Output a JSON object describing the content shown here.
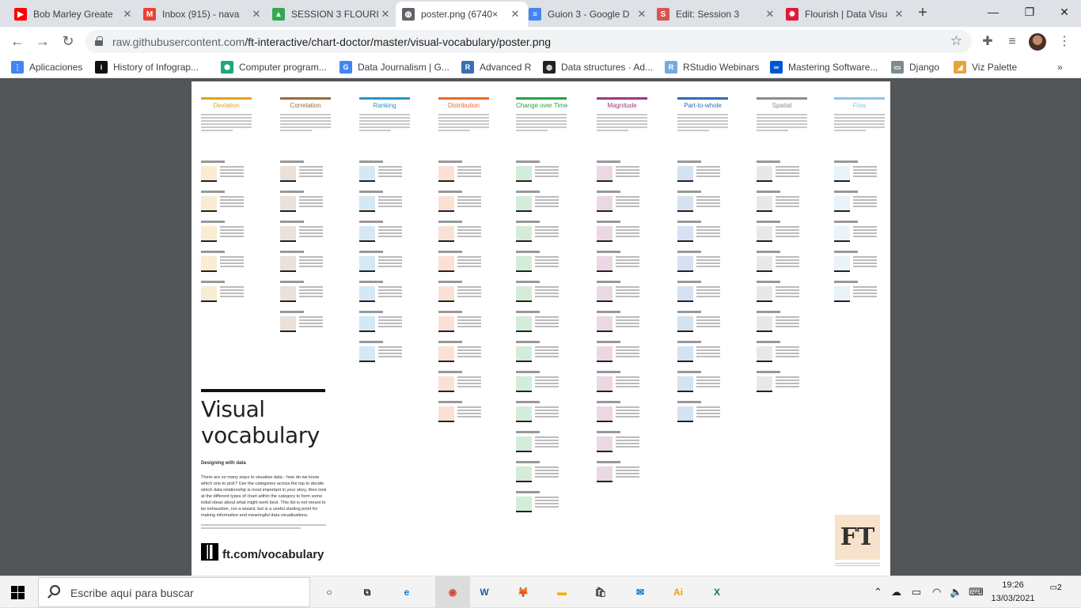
{
  "browser": {
    "tabs": [
      {
        "title": "Bob Marley Greate",
        "icon": "youtube-icon",
        "color": "#ff0000",
        "glyph": "▶"
      },
      {
        "title": "Inbox (915) - nava",
        "icon": "gmail-icon",
        "color": "#ea4335",
        "glyph": "M"
      },
      {
        "title": "SESSION 3 FLOURI",
        "icon": "google-drive-icon",
        "color": "#34a853",
        "glyph": "▲"
      },
      {
        "title": "poster.png (6740×",
        "icon": "globe-icon",
        "color": "#5f6368",
        "glyph": "◍"
      },
      {
        "title": "Guion 3 - Google D",
        "icon": "google-docs-icon",
        "color": "#4285f4",
        "glyph": "≡"
      },
      {
        "title": "Edit: Session 3",
        "icon": "s-site-icon",
        "color": "#d9534f",
        "glyph": "S"
      },
      {
        "title": "Flourish | Data Visu",
        "icon": "flourish-icon",
        "color": "#e0193a",
        "glyph": "✹"
      }
    ],
    "active_tab": 3,
    "new_tab": "+",
    "window_controls": {
      "minimize": "—",
      "maximize": "❐",
      "close": "✕"
    },
    "address": {
      "host": "raw.githubusercontent.com",
      "path": "/ft-interactive/chart-doctor/master/visual-vocabulary/poster.png"
    },
    "nav": {
      "back": "←",
      "forward": "→",
      "reload": "↻"
    },
    "bookmarks": [
      {
        "label": "Aplicaciones",
        "icon": "apps-grid-icon",
        "color": "#4285f4",
        "glyph": "⋮"
      },
      {
        "label": "History of Infograp...",
        "icon": "info-icon",
        "color": "#111111",
        "glyph": "i"
      },
      {
        "label": "Computer program...",
        "icon": "hexagon-icon",
        "color": "#1fa67a",
        "glyph": "⬢"
      },
      {
        "label": "Data Journalism | G...",
        "icon": "google-g-icon",
        "color": "#4285f4",
        "glyph": "G"
      },
      {
        "label": "Advanced R",
        "icon": "r-icon",
        "color": "#3b6fb6",
        "glyph": "R"
      },
      {
        "label": "Data structures · Ad...",
        "icon": "globe-icon",
        "color": "#222222",
        "glyph": "◍"
      },
      {
        "label": "RStudio Webinars",
        "icon": "r-icon",
        "color": "#75aadb",
        "glyph": "R"
      },
      {
        "label": "Mastering Software...",
        "icon": "coursera-icon",
        "color": "#0056d2",
        "glyph": "∞"
      },
      {
        "label": "Django",
        "icon": "folder-icon",
        "color": "#7f8c8d",
        "glyph": "▭"
      },
      {
        "label": "Viz Palette",
        "icon": "palette-icon",
        "color": "#e8a33b",
        "glyph": "◢"
      }
    ],
    "bookmarks_more": "»"
  },
  "poster": {
    "columns": [
      {
        "title": "Deviation",
        "color": "#e6a21c"
      },
      {
        "title": "Correlation",
        "color": "#9c6b3e"
      },
      {
        "title": "Ranking",
        "color": "#2a93c8"
      },
      {
        "title": "Distribution",
        "color": "#ec6a2b"
      },
      {
        "title": "Change over Time",
        "color": "#27a146"
      },
      {
        "title": "Magnitude",
        "color": "#a0387d"
      },
      {
        "title": "Part-to-whole",
        "color": "#2c6cb8"
      },
      {
        "title": "Spatial",
        "color": "#8c8c8c"
      },
      {
        "title": "Flow",
        "color": "#8ec3e6"
      }
    ],
    "title_line1": "Visual",
    "title_line2": "vocabulary",
    "subtitle": "Designing with data",
    "intro": "There are so many ways to visualise data - how do we know which one to pick? Use the categories across the top to decide which data relationship is most important in your story, then look at the different types of chart within the category to form some initial ideas about what might work best. This list is not meant to be exhaustive, nor a wizard, but is a useful starting point for making informative and meaningful data visualisations.",
    "url": "ft.com/vocabulary",
    "logo": "FT"
  },
  "taskbar": {
    "search_placeholder": "Escribe aquí para buscar",
    "apps": [
      {
        "name": "cortana-icon",
        "glyph": "○",
        "color": "#222222"
      },
      {
        "name": "task-view-icon",
        "glyph": "⧉",
        "color": "#222222"
      },
      {
        "name": "edge-icon",
        "glyph": "e",
        "color": "#0c7cd5"
      },
      {
        "name": "chrome-icon",
        "glyph": "◉",
        "color": "#db4437"
      },
      {
        "name": "word-icon",
        "glyph": "W",
        "color": "#2b579a"
      },
      {
        "name": "firefox-icon",
        "glyph": "🦊",
        "color": "#ff7139"
      },
      {
        "name": "file-explorer-icon",
        "glyph": "▬",
        "color": "#f4b400"
      },
      {
        "name": "store-icon",
        "glyph": "🛍",
        "color": "#444444"
      },
      {
        "name": "mail-icon",
        "glyph": "✉",
        "color": "#0072c6"
      },
      {
        "name": "illustrator-icon",
        "glyph": "Ai",
        "color": "#ff9a00"
      },
      {
        "name": "excel-icon",
        "glyph": "X",
        "color": "#217346"
      }
    ],
    "time": "19:26",
    "date": "13/03/2021",
    "notifications": "2"
  }
}
